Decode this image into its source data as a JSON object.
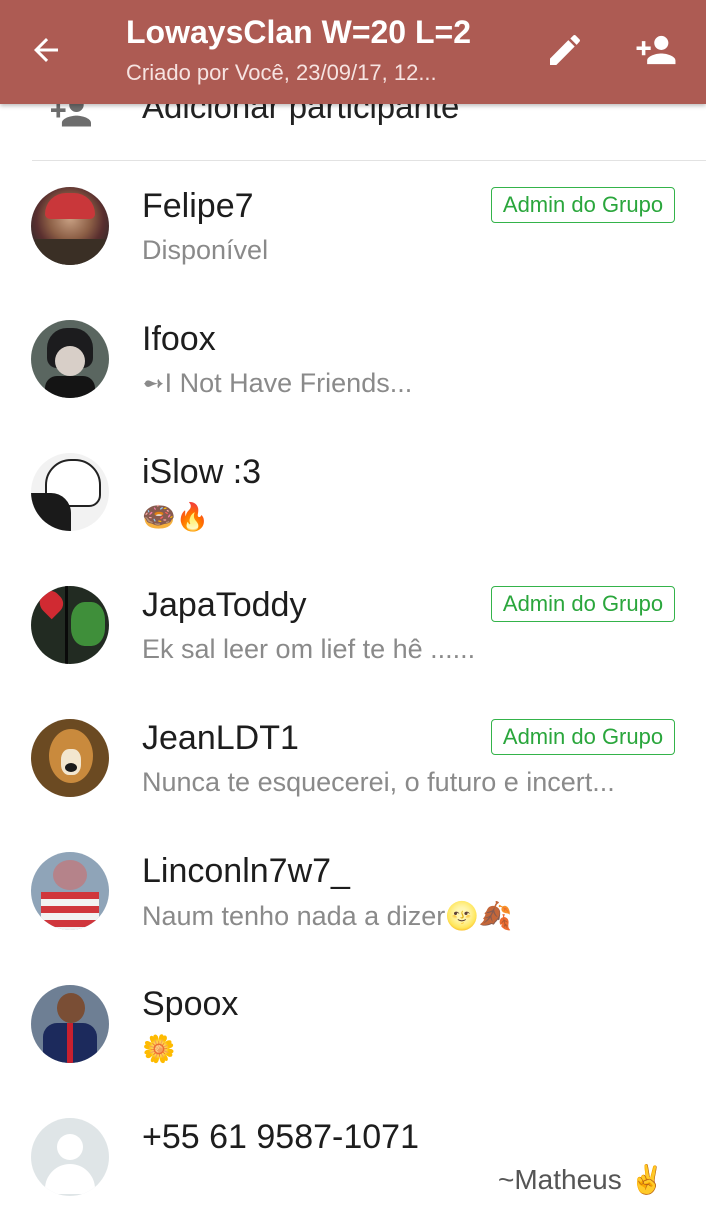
{
  "header": {
    "title": "LowaysClan W=20 L=2",
    "subtitle": "Criado por Você, 23/09/17, 12...",
    "color": "#ad5b53"
  },
  "add_participant": {
    "label": "Adicionar participante",
    "icon": "add-person-icon"
  },
  "badge_label": "Admin do Grupo",
  "participants": [
    {
      "name": "Felipe7",
      "status": "Disponível",
      "admin": true
    },
    {
      "name": "Ifoox",
      "status": "➻I Not Have Friends...",
      "admin": false
    },
    {
      "name": "iSlow :3",
      "status": "🍩🔥",
      "admin": false
    },
    {
      "name": "JapaToddy",
      "status": "Ek sal leer om lief te hê ......",
      "admin": true
    },
    {
      "name": "JeanLDT1",
      "status": "Nunca te esquecerei, o futuro e incert...",
      "admin": true
    },
    {
      "name": "Linconln7w7_",
      "status": "Naum tenho nada a dizer🌝🍂",
      "admin": false
    },
    {
      "name": "Spoox",
      "status": "🌼",
      "admin": false
    },
    {
      "name": "+55 61 9587-1071",
      "status": "",
      "admin": false
    }
  ],
  "footer_signature": "~Matheus ✌️"
}
